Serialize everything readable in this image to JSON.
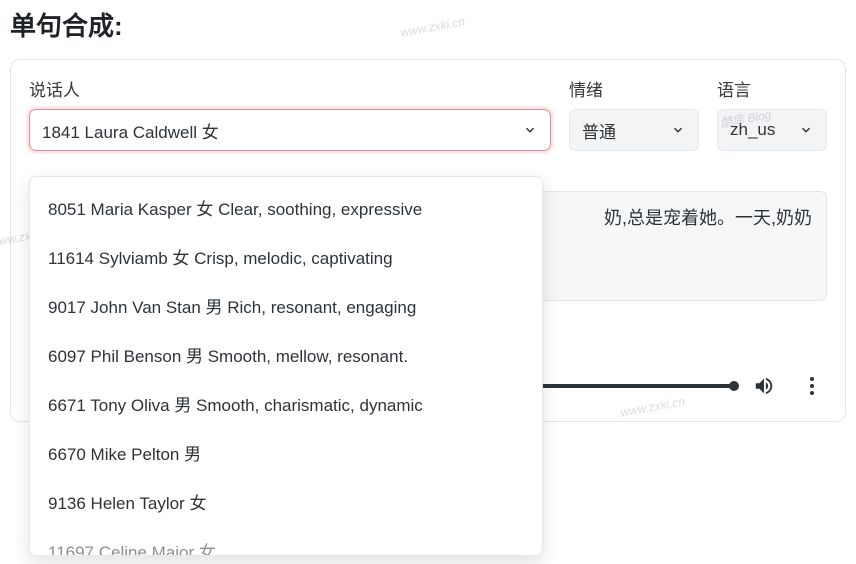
{
  "page_title": "单句合成:",
  "fields": {
    "speaker": {
      "label": "说话人",
      "selected": "1841 Laura Caldwell 女",
      "options": [
        "8051 Maria Kasper 女 Clear, soothing, expressive",
        "11614 Sylviamb 女 Crisp, melodic, captivating",
        "9017 John Van Stan 男 Rich, resonant, engaging",
        "6097 Phil Benson 男 Smooth, mellow, resonant.",
        "6671 Tony Oliva 男 Smooth, charismatic, dynamic",
        "6670 Mike Pelton 男",
        "9136 Helen Taylor 女",
        "11697 Celine Major 女"
      ]
    },
    "emotion": {
      "label": "情绪",
      "selected": "普通"
    },
    "language": {
      "label": "语言",
      "selected": "zh_us"
    }
  },
  "textarea_value": "奶,总是宠着她。一天,奶奶",
  "watermark_text": "酷库 Blog",
  "watermark_url": "www.zxki.cn"
}
